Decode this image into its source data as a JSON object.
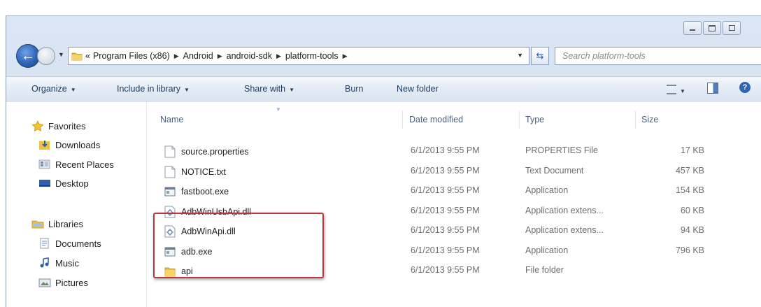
{
  "address": {
    "crumb_prefix": "«",
    "crumbs": [
      "Program Files (x86)",
      "Android",
      "android-sdk",
      "platform-tools"
    ],
    "search_placeholder": "Search platform-tools"
  },
  "toolbar": {
    "organize": "Organize",
    "include_in_library": "Include in library",
    "share_with": "Share with",
    "burn": "Burn",
    "new_folder": "New folder"
  },
  "sidebar": {
    "favorites": "Favorites",
    "favorites_items": [
      "Downloads",
      "Recent Places",
      "Desktop"
    ],
    "libraries": "Libraries",
    "libraries_items": [
      "Documents",
      "Music",
      "Pictures"
    ]
  },
  "columns": {
    "name": "Name",
    "date": "Date modified",
    "type": "Type",
    "size": "Size"
  },
  "files": [
    {
      "name": "source.properties",
      "date": "6/1/2013 9:55 PM",
      "type": "PROPERTIES File",
      "size": "17 KB",
      "icon": "document-icon"
    },
    {
      "name": "NOTICE.txt",
      "date": "6/1/2013 9:55 PM",
      "type": "Text Document",
      "size": "457 KB",
      "icon": "document-icon"
    },
    {
      "name": "fastboot.exe",
      "date": "6/1/2013 9:55 PM",
      "type": "Application",
      "size": "154 KB",
      "icon": "application-icon"
    },
    {
      "name": "AdbWinUsbApi.dll",
      "date": "6/1/2013 9:55 PM",
      "type": "Application extens...",
      "size": "60 KB",
      "icon": "dll-icon"
    },
    {
      "name": "AdbWinApi.dll",
      "date": "6/1/2013 9:55 PM",
      "type": "Application extens...",
      "size": "94 KB",
      "icon": "dll-icon"
    },
    {
      "name": "adb.exe",
      "date": "6/1/2013 9:55 PM",
      "type": "Application",
      "size": "796 KB",
      "icon": "application-icon"
    },
    {
      "name": "api",
      "date": "6/1/2013 9:55 PM",
      "type": "File folder",
      "size": "",
      "icon": "folder-icon"
    }
  ],
  "colors": {
    "highlight_box": "#b8383d",
    "accent_blue": "#2d64b4"
  }
}
